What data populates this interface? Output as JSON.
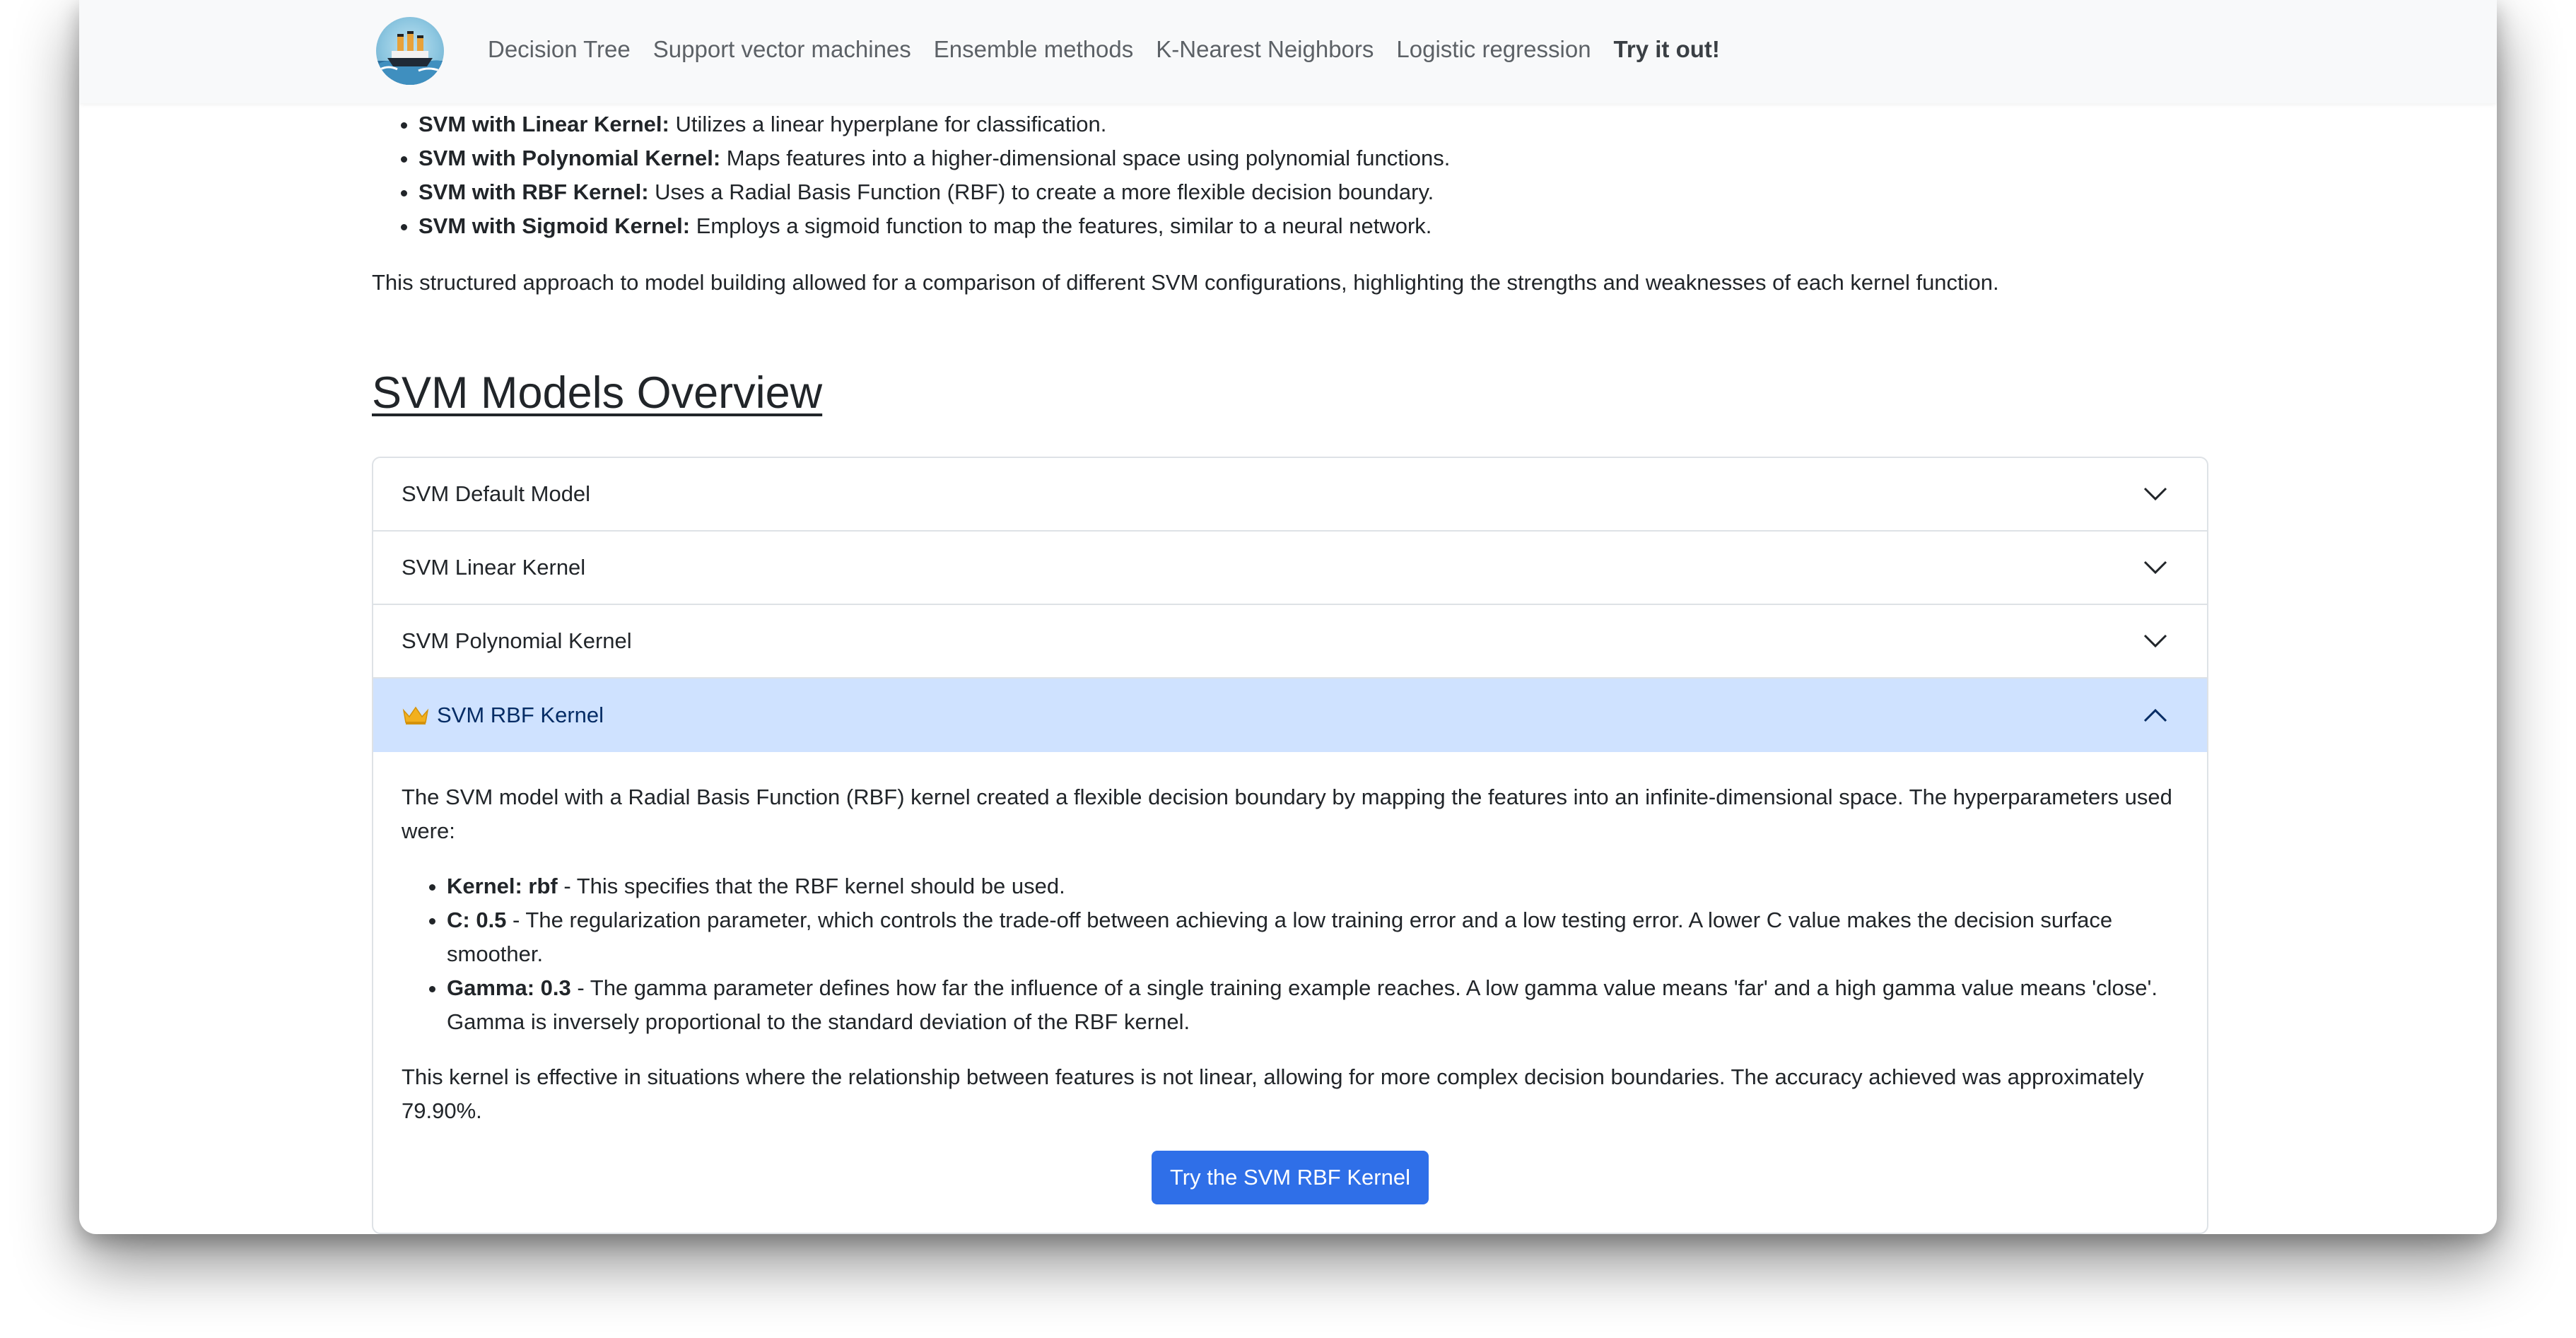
{
  "navbar": {
    "logo_icon": "ship-logo-icon",
    "links": [
      {
        "label": "Decision Tree"
      },
      {
        "label": "Support vector machines"
      },
      {
        "label": "Ensemble methods"
      },
      {
        "label": "K-Nearest Neighbors"
      },
      {
        "label": "Logistic regression"
      },
      {
        "label": "Try it out!"
      }
    ]
  },
  "features": [
    {
      "bold": "SVM with Linear Kernel:",
      "text": " Utilizes a linear hyperplane for classification."
    },
    {
      "bold": "SVM with Polynomial Kernel:",
      "text": " Maps features into a higher-dimensional space using polynomial functions."
    },
    {
      "bold": "SVM with RBF Kernel:",
      "text": " Uses a Radial Basis Function (RBF) to create a more flexible decision boundary."
    },
    {
      "bold": "SVM with Sigmoid Kernel:",
      "text": " Employs a sigmoid function to map the features, similar to a neural network."
    }
  ],
  "intro_paragraph": "This structured approach to model building allowed for a comparison of different SVM configurations, highlighting the strengths and weaknesses of each kernel function.",
  "section_title": "SVM Models Overview",
  "accordion": {
    "items": [
      {
        "label": "SVM Default Model"
      },
      {
        "label": "SVM Linear Kernel"
      },
      {
        "label": "SVM Polynomial Kernel"
      },
      {
        "label": "SVM RBF Kernel"
      }
    ],
    "open_body": {
      "description": "The SVM model with a Radial Basis Function (RBF) kernel created a flexible decision boundary by mapping the features into an infinite-dimensional space. The hyperparameters used were:",
      "params": [
        {
          "bold": "Kernel: rbf",
          "text": " - This specifies that the RBF kernel should be used."
        },
        {
          "bold": "C: 0.5",
          "text": " - The regularization parameter, which controls the trade-off between achieving a low training error and a low testing error. A lower C value makes the decision surface smoother."
        },
        {
          "bold": "Gamma: 0.3",
          "text": " - The gamma parameter defines how far the influence of a single training example reaches. A low gamma value means 'far' and a high gamma value means 'close'. Gamma is inversely proportional to the standard deviation of the RBF kernel."
        }
      ],
      "summary": "This kernel is effective in situations where the relationship between features is not linear, allowing for more complex decision boundaries. The accuracy achieved was approximately 79.90%.",
      "button_label": "Try the SVM RBF Kernel"
    }
  },
  "colors": {
    "accent": "#2f6fe8",
    "open_header_bg": "#cfe2ff",
    "crown": "#f2b01e"
  }
}
